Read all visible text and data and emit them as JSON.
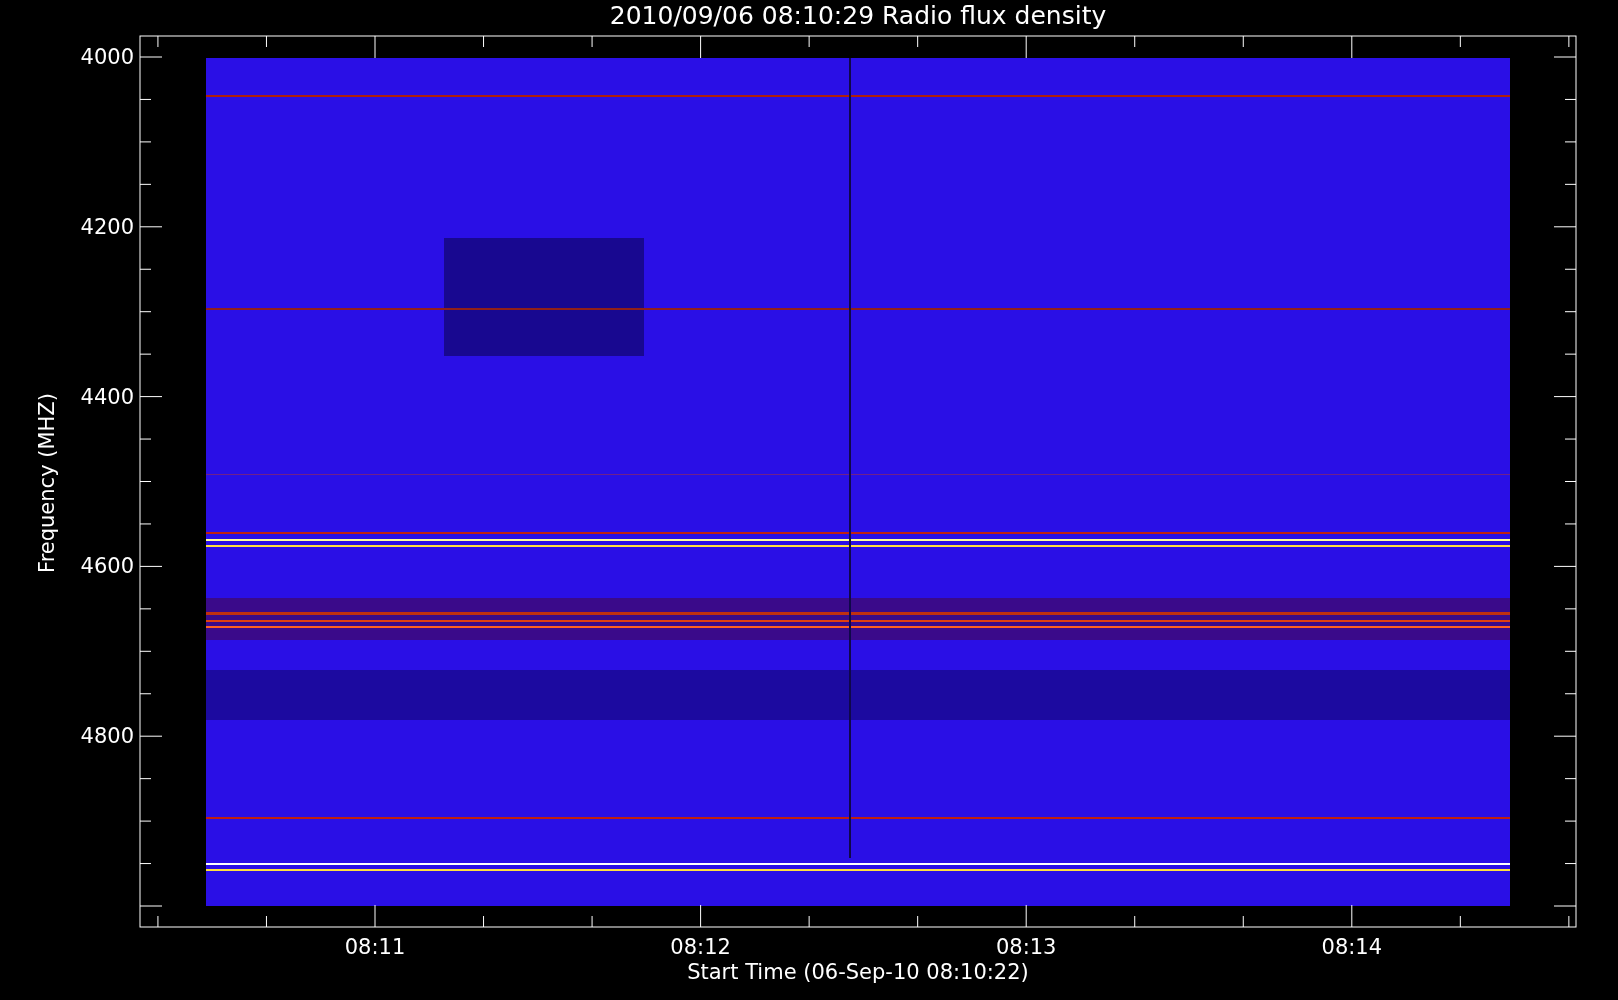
{
  "title": "2010/09/06 08:10:29 Radio flux density",
  "ylabel": "Frequency (MHZ)",
  "xlabel": "Start Time (06-Sep-10 08:10:22)",
  "yticks": [
    "4000",
    "4200",
    "4400",
    "4600",
    "4800"
  ],
  "xticks": [
    "08:11",
    "08:12",
    "08:13",
    "08:14"
  ]
}
